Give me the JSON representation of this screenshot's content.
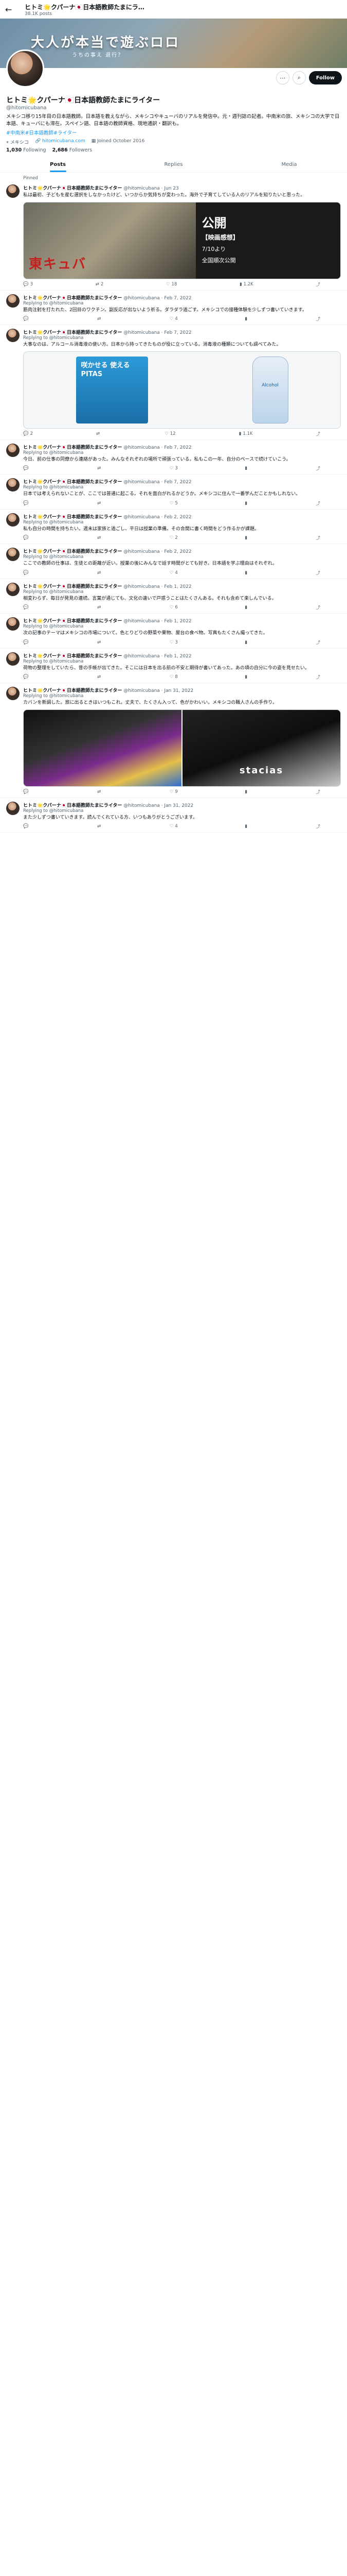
{
  "header": {
    "name": "ヒトミ🌟クパーナ🇯🇵日本語教師たまにラ…",
    "count": "38.1K posts"
  },
  "banner": {
    "title": "大人が本当で遊ぶロロ",
    "sub": "うちの事え 退行？"
  },
  "profile": {
    "name": "ヒトミ🌟クパーナ🇯🇵日本語教師たまにライター",
    "handle": "@hitomicubana",
    "bio": "メキシコ移り15年目の日本語教師。日本語を教えながら、メキシコやキューバのリアルを発信中。元・週刊誌の記者。中南米の旅、メキシコの大学で日本語、キューバにも滞在。スペイン語、日本語の教師資格、現地通訳・翻訳も。",
    "hashtags": "#中南米#日本語教師#ライター",
    "location": "メキシコ",
    "website": "hitomicubana.com",
    "joined": "Joined October 2016",
    "following": "1,030",
    "following_label": "Following",
    "followers": "2,686",
    "followers_label": "Followers",
    "follow_label": "Follow"
  },
  "tabs": [
    "Posts",
    "Replies",
    "Media"
  ],
  "tweets": [
    {
      "name": "ヒトミ🌟クパーナ🇯🇵日本語教師たまにライター",
      "handle": "@hitomicubana · Jun 23",
      "reply": "",
      "text": "私は最初、子どもを産む選択をしなかったけど、いつからか気持ちが変わった。海外で子育てしている人のリアルを知りたいと思った。",
      "replies": "3",
      "rts": "2",
      "likes": "18",
      "views": "1.2K"
    },
    {
      "name": "ヒトミ🌟クパーナ🇯🇵日本語教師たまにライター",
      "handle": "@hitomicubana · Feb 7, 2022",
      "reply": "Replying to @hitomicubana",
      "text": "筋肉注射を打たれた、2回目のワクチン。副反応が出ないよう祈る。ダラダラ過ごす。メキシコでの接種体験を少しずつ書いていきます。",
      "replies": "",
      "rts": "",
      "likes": "4",
      "views": ""
    },
    {
      "name": "ヒトミ🌟クパーナ🇯🇵日本語教師たまにライター",
      "handle": "@hitomicubana · Feb 7, 2022",
      "reply": "Replying to @hitomicubana",
      "text": "大事なのは、アルコール消毒液の使い方。日本から持ってきたものが役に立っている。消毒液の種類についても調べてみた。",
      "replies": "2",
      "rts": "",
      "likes": "12",
      "views": "1.1K"
    },
    {
      "name": "ヒトミ🌟クパーナ🇯🇵日本語教師たまにライター",
      "handle": "@hitomicubana · Feb 7, 2022",
      "reply": "Replying to @hitomicubana",
      "text": "今日、前の仕事の同僚から連絡があった。みんなそれぞれの場所で頑張っている。私もこの一年、自分のペースで続けていこう。",
      "replies": "",
      "rts": "",
      "likes": "3",
      "views": ""
    },
    {
      "name": "ヒトミ🌟クパーナ🇯🇵日本語教師たまにライター",
      "handle": "@hitomicubana · Feb 7, 2022",
      "reply": "Replying to @hitomicubana",
      "text": "日本では考えられないことが、ここでは普通に起こる。それを面白がれるかどうか。メキシコに住んで一番学んだことかもしれない。",
      "replies": "",
      "rts": "",
      "likes": "5",
      "views": ""
    },
    {
      "name": "ヒトミ🌟クパーナ🇯🇵日本語教師たまにライター",
      "handle": "@hitomicubana · Feb 2, 2022",
      "reply": "Replying to @hitomicubana",
      "text": "私も自分の時間を持ちたい。週末は家族と過ごし、平日は授業の準備。その合間に書く時間をどう作るかが課題。",
      "replies": "",
      "rts": "",
      "likes": "2",
      "views": ""
    },
    {
      "name": "ヒトミ🌟クパーナ🇯🇵日本語教師たまにライター",
      "handle": "@hitomicubana · Feb 2, 2022",
      "reply": "Replying to @hitomicubana",
      "text": "ここでの教師の仕事は、生徒との距離が近い。授業の後にみんなで話す時間がとても好き。日本語を学ぶ理由はそれぞれ。",
      "replies": "",
      "rts": "",
      "likes": "4",
      "views": ""
    },
    {
      "name": "ヒトミ🌟クパーナ🇯🇵日本語教師たまにライター",
      "handle": "@hitomicubana · Feb 1, 2022",
      "reply": "Replying to @hitomicubana",
      "text": "相変わらず、毎日が発見の連続。言葉が通じても、文化の違いで戸惑うことはたくさんある。それも含めて楽しんでいる。",
      "replies": "",
      "rts": "",
      "likes": "6",
      "views": ""
    },
    {
      "name": "ヒトミ🌟クパーナ🇯🇵日本語教師たまにライター",
      "handle": "@hitomicubana · Feb 1, 2022",
      "reply": "Replying to @hitomicubana",
      "text": "次の記事のテーマはメキシコの市場について。色とりどりの野菜や果物、屋台の食べ物。写真もたくさん撮ってきた。",
      "replies": "",
      "rts": "",
      "likes": "3",
      "views": ""
    },
    {
      "name": "ヒトミ🌟クパーナ🇯🇵日本語教師たまにライター",
      "handle": "@hitomicubana · Feb 1, 2022",
      "reply": "Replying to @hitomicubana",
      "text": "荷物の整理をしていたら、昔の手帳が出てきた。そこには日本を出る前の不安と期待が書いてあった。あの頃の自分に今の姿を見せたい。",
      "replies": "",
      "rts": "",
      "likes": "8",
      "views": ""
    },
    {
      "name": "ヒトミ🌟クパーナ🇯🇵日本語教師たまにライター",
      "handle": "@hitomicubana · Jan 31, 2022",
      "reply": "Replying to @hitomicubana",
      "text": "カバンを新調した。旅に出るときはいつもこれ。丈夫で、たくさん入って、色がかわいい。メキシコの職人さんの手作り。",
      "replies": "",
      "rts": "",
      "likes": "9",
      "views": ""
    },
    {
      "name": "ヒトミ🌟クパーナ🇯🇵日本語教師たまにライター",
      "handle": "@hitomicubana · Jan 31, 2022",
      "reply": "Replying to @hitomicubana",
      "text": "また少しずつ書いていきます。読んでくれている方、いつもありがとうございます。",
      "replies": "",
      "rts": "",
      "likes": "4",
      "views": ""
    }
  ],
  "media": {
    "film_tag": "【映画感想】",
    "film_date": "7/10より",
    "film_note": "全国順次公開",
    "film_big": "公開",
    "film_red": "東キュバ",
    "pkg_text": "咲かせる 使える PITAS",
    "bottle_text": "Alcohol",
    "bag_text": "stacias"
  },
  "pinned_label": "Pinned"
}
